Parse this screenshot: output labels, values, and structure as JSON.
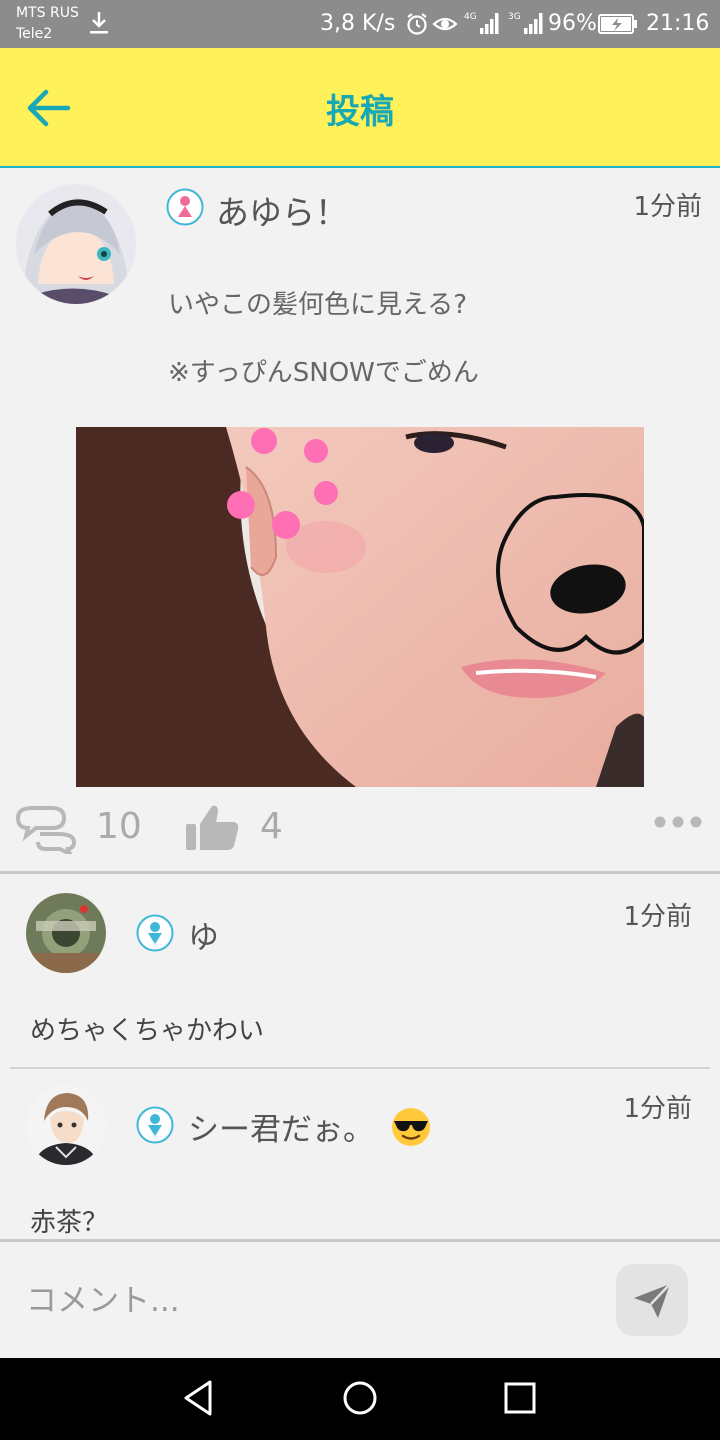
{
  "status_bar": {
    "carrier_1": "MTS RUS",
    "carrier_2": "Tele2",
    "net_speed": "3,8 K/s",
    "signal_1": "4G",
    "signal_2": "3G",
    "battery": "96%",
    "time": "21:16",
    "icons": [
      "download-icon",
      "alarm-icon",
      "eye-icon",
      "signal-icon",
      "signal-icon",
      "battery-charging-icon"
    ]
  },
  "header": {
    "title": "投稿",
    "back_icon": "arrow-left-icon"
  },
  "colors": {
    "header_bg": "#fff159",
    "accent": "#17a7b5",
    "female_icon": "#f06b95",
    "male_icon": "#3fb8d8"
  },
  "post": {
    "author": "あゆら！",
    "gender": "female",
    "time": "1分前",
    "text_1": "いやこの髪何色に見える?",
    "text_2": "※すっぴんSNOWでごめん",
    "comment_count": "10",
    "like_count": "4"
  },
  "comments": [
    {
      "name": "ゆ",
      "gender": "male",
      "time": "1分前",
      "text": "めちゃくちゃかわい"
    },
    {
      "name": "シー君だぉ。",
      "gender": "male",
      "time": "1分前",
      "text": "赤茶？",
      "emoji": "sunglasses-emoji"
    }
  ],
  "input": {
    "placeholder": "コメント..."
  },
  "nav": [
    "back-icon",
    "home-icon",
    "recent-apps-icon"
  ]
}
